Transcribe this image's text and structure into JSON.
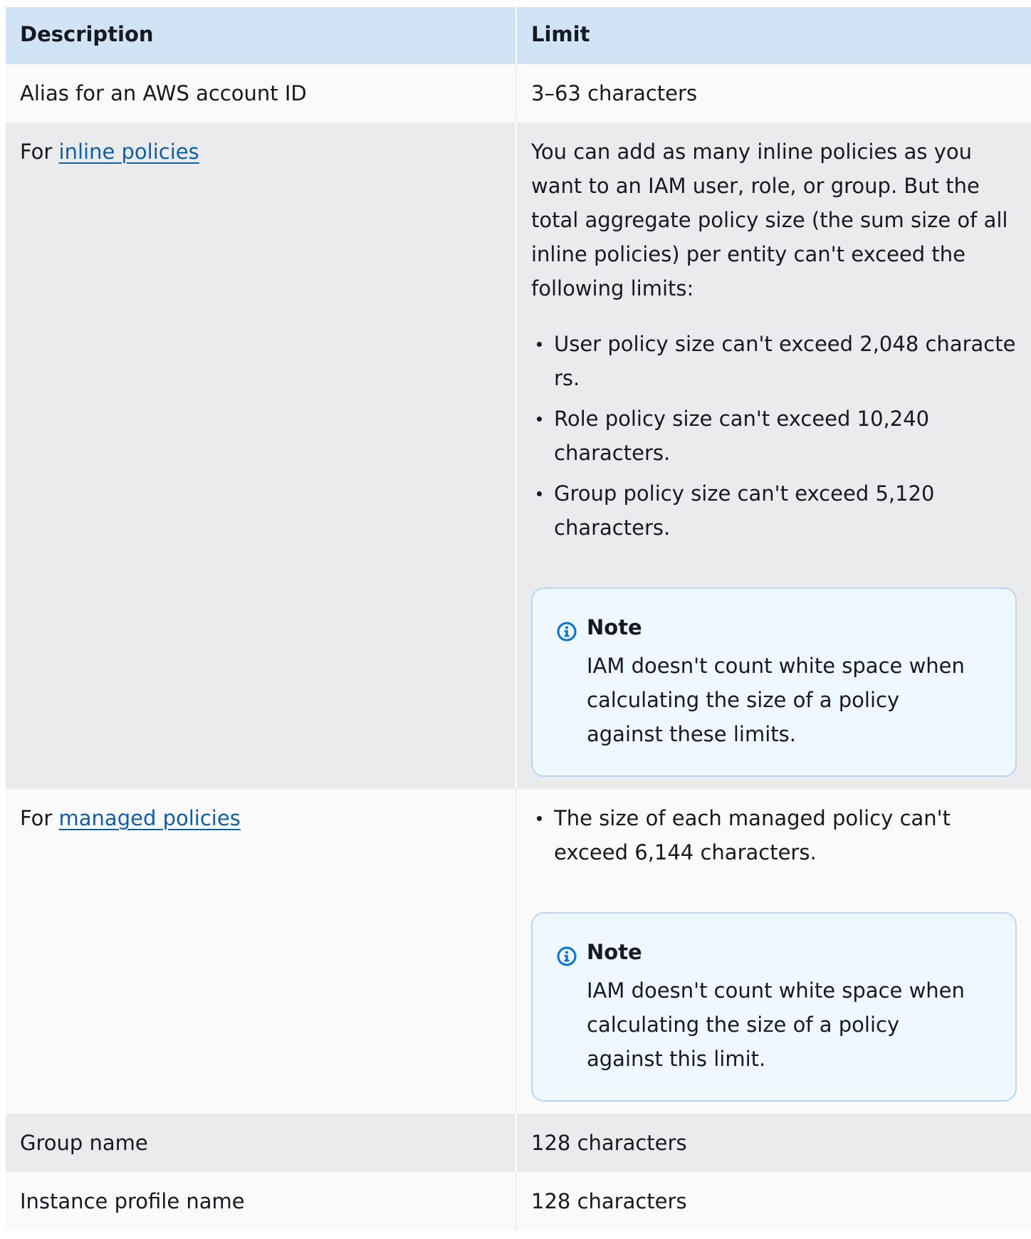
{
  "table": {
    "headers": {
      "description": "Description",
      "limit": "Limit"
    },
    "rows": [
      {
        "description": "Alias for an AWS account ID",
        "limit": "3–63 characters"
      },
      {
        "description_prefix": "For ",
        "description_link": "inline policies",
        "limit_intro": "You can add as many inline policies as you want to an IAM user, role, or group. But the total aggregate policy size (the sum size of all inline policies) per entity can't exceed the following limits:",
        "bullets": [
          "User policy size can't exceed 2,048 characters.",
          "Role policy size can't exceed 10,240 characters.",
          "Group policy size can't exceed 5,120 characters."
        ],
        "note_title": "Note",
        "note_body": "IAM doesn't count white space when calculating the size of a policy against these limits."
      },
      {
        "description_prefix": "For ",
        "description_link": "managed policies",
        "bullets": [
          "The size of each managed policy can't exceed 6,144 characters."
        ],
        "note_title": "Note",
        "note_body": "IAM doesn't count white space when calculating the size of a policy against this limit."
      },
      {
        "description": "Group name",
        "limit": "128 characters"
      },
      {
        "description": "Instance profile name",
        "limit": "128 characters"
      }
    ]
  },
  "colors": {
    "header_bg": "#d1e4f5",
    "row_light": "#fafafa",
    "row_gray": "#e9ebed",
    "link": "#0f5fa6",
    "note_bg": "#f0f8ff",
    "note_border": "#b9d7f1",
    "info_icon": "#0972d3"
  },
  "icons": {
    "note": "info-circle-icon"
  }
}
